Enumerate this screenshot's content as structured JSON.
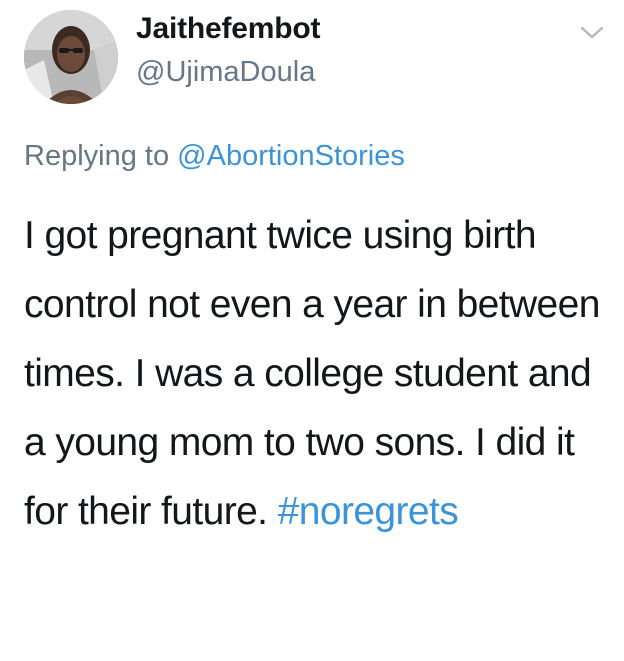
{
  "user": {
    "display_name": "Jaithefembot",
    "handle": "@UjimaDoula"
  },
  "reply": {
    "prefix": "Replying to",
    "mention": "@AbortionStories"
  },
  "tweet": {
    "text": "I got pregnant twice using birth control not even a year in between times. I was a college student and a young mom to two sons. I did it for their future.",
    "hashtag": "#noregrets"
  },
  "icons": {
    "menu": "chevron-down-icon"
  },
  "colors": {
    "link": "#3b94d9",
    "secondary_text": "#657786",
    "primary_text": "#14171a"
  }
}
